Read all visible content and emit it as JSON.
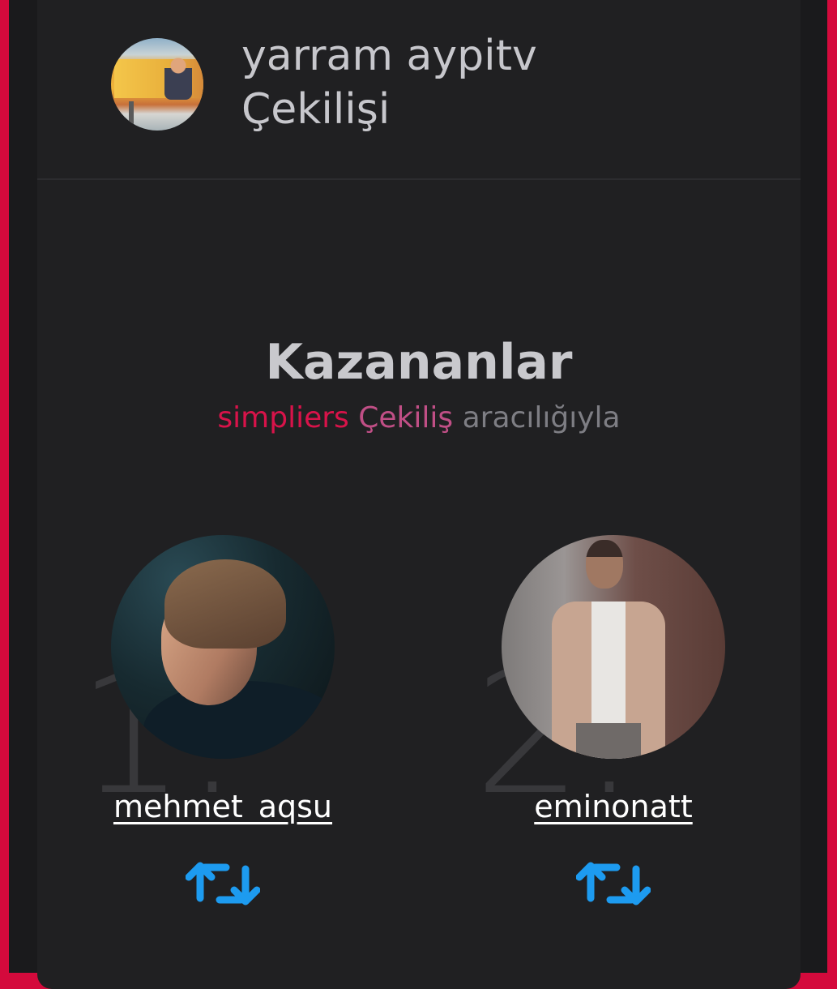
{
  "header": {
    "title_line1": "yarram aypitv",
    "title_line2": "Çekilişi"
  },
  "winners_section": {
    "heading": "Kazananlar",
    "via": {
      "brand": "simpliers",
      "product": "Çekiliş",
      "suffix": "aracılığıyla"
    }
  },
  "winners": [
    {
      "rank": "1.",
      "username": "mehmet_aqsu",
      "action_icon": "retweet-icon"
    },
    {
      "rank": "2.",
      "username": "eminonatt",
      "action_icon": "retweet-icon"
    }
  ],
  "colors": {
    "frame": "#d40a3c",
    "card_background": "#202022",
    "brand_red": "#d8134a",
    "brand_pink": "#c04f86",
    "retweet_blue": "#1d9bf0"
  }
}
